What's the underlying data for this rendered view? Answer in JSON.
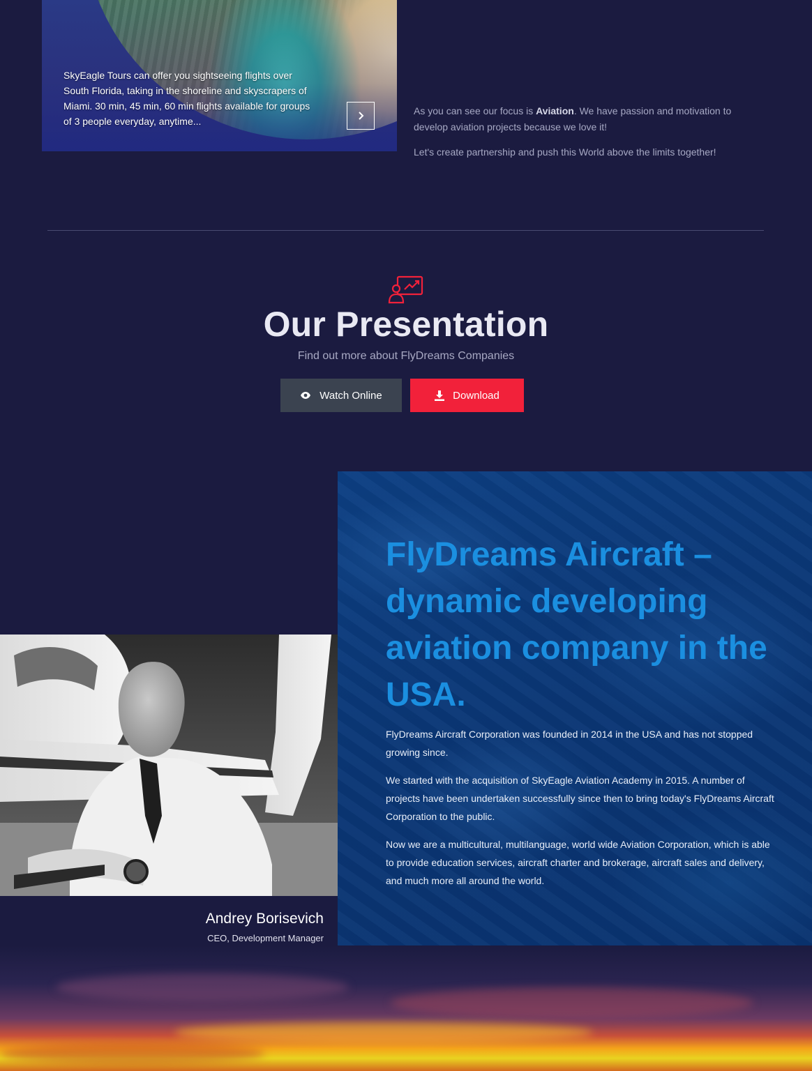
{
  "promo": {
    "text": "SkyEagle Tours can offer you sightseeing flights over South Florida, taking in the shoreline and skyscrapers of Miami. 30 min, 45 min, 60 min flights available for groups of 3 people everyday, anytime...",
    "next_icon": "chevron-right-icon"
  },
  "focus": {
    "p1_before": "As you can see our focus is ",
    "p1_strong": "Aviation",
    "p1_after": ". We have passion and motivation to develop aviation projects because we love it!",
    "p2": "Let's create partnership and push this World above the limits together!"
  },
  "presentation": {
    "icon": "presentation-chart-icon",
    "title": "Our Presentation",
    "subtitle": "Find out more about FlyDreams Companies",
    "watch_label": "Watch Online",
    "watch_icon": "eye-icon",
    "download_label": "Download",
    "download_icon": "download-icon"
  },
  "about": {
    "heading": "FlyDreams Aircraft – dynamic developing aviation company in the USA.",
    "paragraphs": [
      "FlyDreams Aircraft Corporation was founded in 2014 in the USA and has not stopped growing since.",
      "We started with the acquisition of SkyEagle Aviation Academy in 2015. A number of projects have been undertaken successfully since then to bring today's FlyDreams Aircraft Corporation to the public.",
      "Now we are a multicultural, multilanguage, world wide Aviation Corporation, which is able to provide education services, aircraft charter and brokerage, aircraft sales and delivery, and much more all around the world."
    ]
  },
  "ceo": {
    "name": "Andrey Borisevich",
    "role": "CEO, Development Manager"
  },
  "colors": {
    "background": "#1b1b40",
    "accent_red": "#f2213a",
    "accent_blue": "#1b8fe0",
    "button_gray": "#3b4350"
  }
}
